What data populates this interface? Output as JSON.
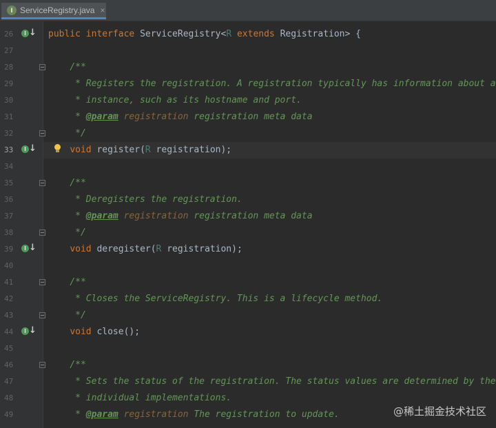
{
  "tab": {
    "file_name": "ServiceRegistry.java",
    "close_label": "×"
  },
  "current_line": "33",
  "lines": [
    {
      "num": "26",
      "code": "public interface ServiceRegistry<R extends Registration> {"
    },
    {
      "num": "27",
      "code": ""
    },
    {
      "num": "28",
      "code": "    /**"
    },
    {
      "num": "29",
      "code": "     * Registers the registration. A registration typically has information about an"
    },
    {
      "num": "30",
      "code": "     * instance, such as its hostname and port."
    },
    {
      "num": "31",
      "code": "     * @param registration registration meta data"
    },
    {
      "num": "32",
      "code": "     */"
    },
    {
      "num": "33",
      "code": "    void register(R registration);"
    },
    {
      "num": "34",
      "code": ""
    },
    {
      "num": "35",
      "code": "    /**"
    },
    {
      "num": "36",
      "code": "     * Deregisters the registration."
    },
    {
      "num": "37",
      "code": "     * @param registration registration meta data"
    },
    {
      "num": "38",
      "code": "     */"
    },
    {
      "num": "39",
      "code": "    void deregister(R registration);"
    },
    {
      "num": "40",
      "code": ""
    },
    {
      "num": "41",
      "code": "    /**"
    },
    {
      "num": "42",
      "code": "     * Closes the ServiceRegistry. This is a lifecycle method."
    },
    {
      "num": "43",
      "code": "     */"
    },
    {
      "num": "44",
      "code": "    void close();"
    },
    {
      "num": "45",
      "code": ""
    },
    {
      "num": "46",
      "code": "    /**"
    },
    {
      "num": "47",
      "code": "     * Sets the status of the registration. The status values are determined by the"
    },
    {
      "num": "48",
      "code": "     * individual implementations."
    },
    {
      "num": "49",
      "code": "     * @param registration The registration to update."
    }
  ],
  "watermark": "@稀土掘金技术社区",
  "colors": {
    "background": "#2b2b2b",
    "gutter": "#313335",
    "keyword": "#cc7832",
    "doc_comment": "#629755",
    "identifier": "#a9b7c6",
    "line_number": "#606366",
    "tab_underline": "#4a88c7"
  },
  "icons": {
    "file": "java-interface-icon",
    "implemented": "implemented-arrow-icon",
    "intention": "lightbulb-icon"
  }
}
